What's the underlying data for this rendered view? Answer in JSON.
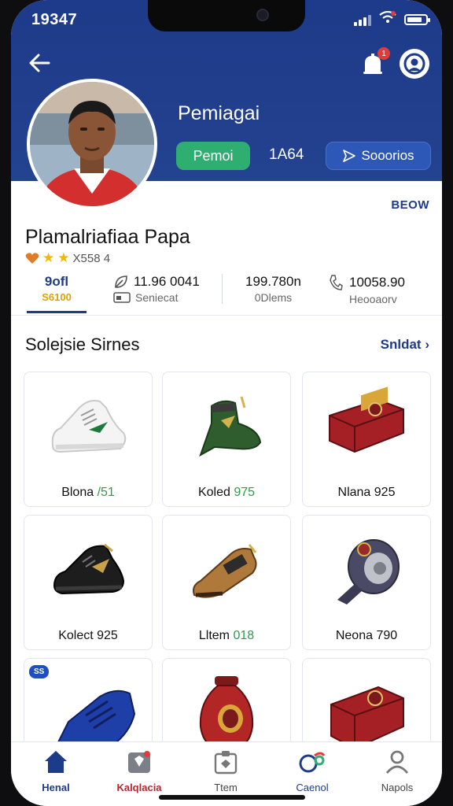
{
  "status_bar": {
    "time": "19347"
  },
  "header": {
    "title": "Pemiagai",
    "pill_green": "Pemoi",
    "stat": "1A64",
    "pill_blue": "Sooorios"
  },
  "profile": {
    "below_link": "BEOW",
    "name": "Plamalriafiaa Papa",
    "rating_text": "X558 4",
    "stars": 2
  },
  "stats": [
    {
      "value": "9ofl",
      "label": "S6100"
    },
    {
      "value": "11.96 0041",
      "label": "Seniecat"
    },
    {
      "value": "199.780n",
      "label": "0Dlems"
    },
    {
      "value": "10058.90",
      "label": "Heooaorv"
    }
  ],
  "section": {
    "title": "Solejsie Sirnes",
    "see_all": "Snldat"
  },
  "products": [
    {
      "name": "Blona ",
      "highlight": "/51",
      "icon": "white-sneaker-icon"
    },
    {
      "name": "Koled ",
      "highlight": "975",
      "icon": "green-boot-icon"
    },
    {
      "name": "Nlana 925",
      "highlight": "",
      "icon": "red-case-icon"
    },
    {
      "name": "Kolect 925",
      "highlight": "",
      "icon": "black-boot-icon"
    },
    {
      "name": "Lltem ",
      "highlight": "018",
      "icon": "brown-boot-icon"
    },
    {
      "name": "Neona 790",
      "highlight": "",
      "icon": "tape-roll-icon"
    },
    {
      "name": "",
      "highlight": "",
      "icon": "blue-sneaker-icon",
      "tag": "SS"
    },
    {
      "name": "",
      "highlight": "",
      "icon": "red-vase-icon"
    },
    {
      "name": "",
      "highlight": "",
      "icon": "red-case-icon"
    }
  ],
  "nav": [
    {
      "label": "Henal",
      "icon": "home-icon",
      "color": "#1e3a8a"
    },
    {
      "label": "Kalqlacia",
      "icon": "bag-icon",
      "color": "#b8262f"
    },
    {
      "label": "Ttem",
      "icon": "box-icon",
      "color": "#555555"
    },
    {
      "label": "Caenol",
      "icon": "link-icon",
      "color": "#1e3a8a"
    },
    {
      "label": "Napols",
      "icon": "user-icon",
      "color": "#555555"
    }
  ],
  "colors": {
    "brand": "#1e3a8a",
    "accent_green": "#2fae72",
    "accent_red": "#e23b3b"
  }
}
